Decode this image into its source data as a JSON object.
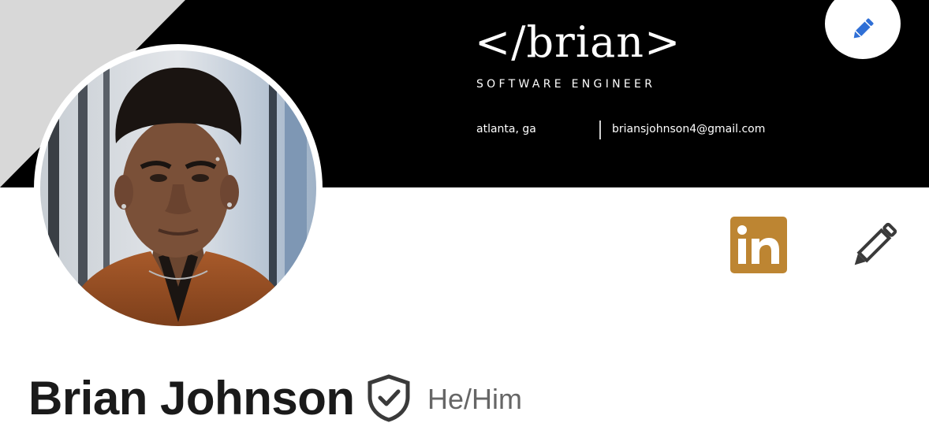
{
  "banner": {
    "logo_text": "</brian>",
    "role": "SOFTWARE ENGINEER",
    "location": "atlanta, ga",
    "email": "briansjohnson4@gmail.com",
    "background_color": "#000000",
    "fold_color": "#d8d8d8"
  },
  "header_actions": {
    "edit_cover_icon": "pencil-icon",
    "edit_cover_color": "#2f6fd6"
  },
  "profile": {
    "avatar_icon": "profile-photo",
    "name": "Brian Johnson",
    "verified_icon": "verified-shield-icon",
    "pronouns": "He/Him"
  },
  "actions": {
    "linkedin_label": "in",
    "linkedin_color": "#bd8532",
    "edit_intro_icon": "pencil-icon"
  }
}
